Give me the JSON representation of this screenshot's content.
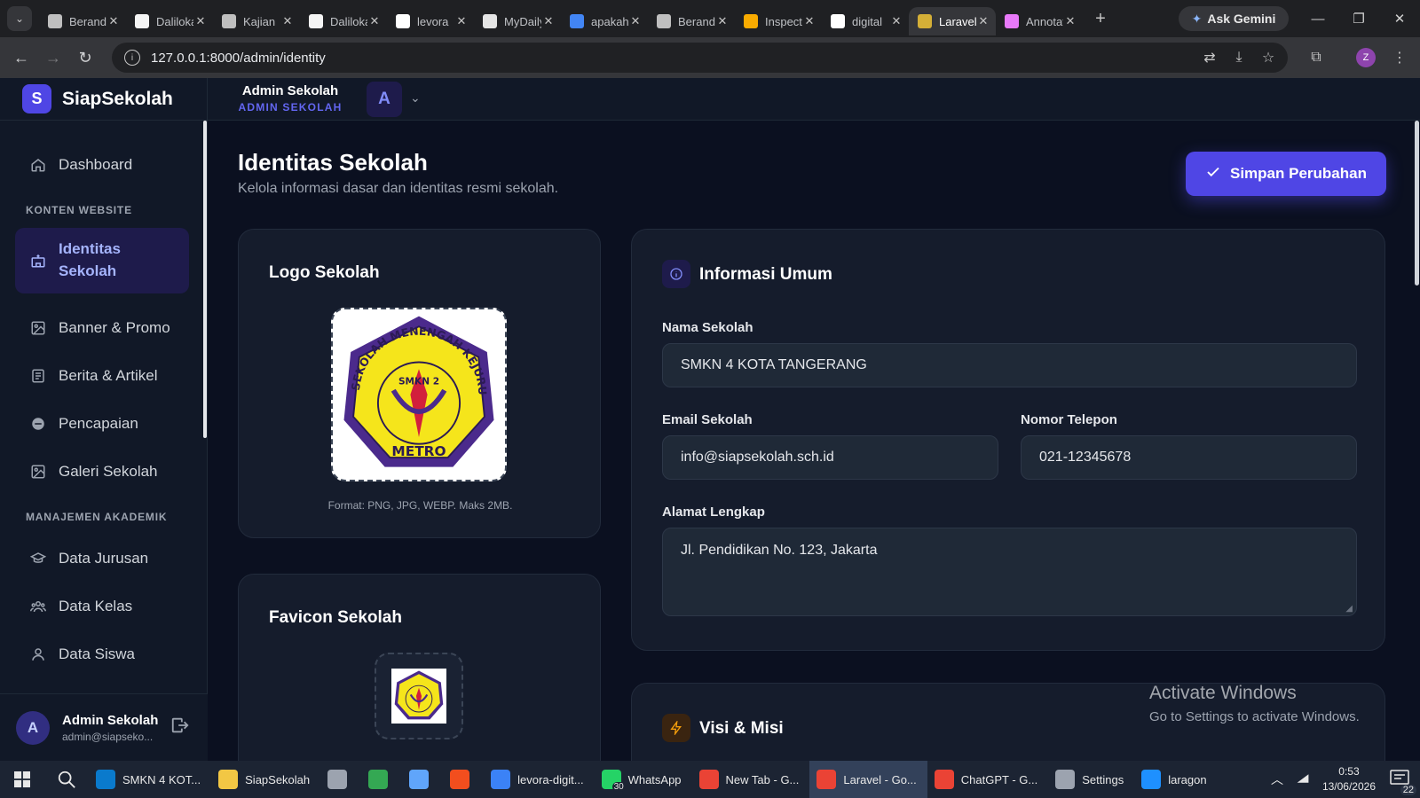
{
  "browser": {
    "tabs": [
      {
        "label": "Beranda",
        "icon": "pen-nib-icon",
        "color": "#bfbfbf"
      },
      {
        "label": "Daliloka",
        "icon": "doc-icon",
        "color": "#f5f5f5"
      },
      {
        "label": "Kajian",
        "icon": "globe-icon",
        "color": "#bfbfbf"
      },
      {
        "label": "Daliloka",
        "icon": "doc-icon",
        "color": "#f5f5f5"
      },
      {
        "label": "levora",
        "icon": "triangle-icon",
        "color": "#ffffff"
      },
      {
        "label": "MyDaily",
        "icon": "check-icon",
        "color": "#e5e5e5"
      },
      {
        "label": "apakah",
        "icon": "google-icon",
        "color": "#4285f4"
      },
      {
        "label": "Beranda",
        "icon": "pen-nib-icon",
        "color": "#bfbfbf"
      },
      {
        "label": "Inspect",
        "icon": "chart-icon",
        "color": "#f9ab00"
      },
      {
        "label": "digital",
        "icon": "triangle-icon",
        "color": "#ffffff"
      },
      {
        "label": "Laravel",
        "icon": "school-logo-icon",
        "color": "#d4af37"
      },
      {
        "label": "Annotate",
        "icon": "ring-icon",
        "color": "#e879f9"
      }
    ],
    "active_tab_index": 10,
    "gemini_label": "Ask Gemini",
    "url": "127.0.0.1:8000/admin/identity",
    "profile_initial": "Z"
  },
  "app": {
    "brand_initial": "S",
    "brand_name": "SiapSekolah",
    "topbar": {
      "user_name": "Admin Sekolah",
      "user_role": "ADMIN SEKOLAH",
      "avatar_initial": "A"
    },
    "sidebar": {
      "dashboard": "Dashboard",
      "section_content": "KONTEN WEBSITE",
      "identity": "Identitas Sekolah",
      "banner": "Banner & Promo",
      "news": "Berita & Artikel",
      "achievement": "Pencapaian",
      "gallery": "Galeri Sekolah",
      "section_academic": "MANAJEMEN AKADEMIK",
      "majors": "Data Jurusan",
      "classes": "Data Kelas",
      "students": "Data Siswa",
      "footer_name": "Admin Sekolah",
      "footer_email": "admin@siapseko...",
      "footer_initial": "A"
    },
    "page": {
      "title": "Identitas Sekolah",
      "subtitle": "Kelola informasi dasar dan identitas resmi sekolah.",
      "save_label": "Simpan Perubahan"
    },
    "logo_card": {
      "title": "Logo Sekolah",
      "hint": "Format: PNG, JPG, WEBP. Maks 2MB.",
      "logo_top_text": "SEKOLAH MENENGAH KEJURUAN NEGERI 2",
      "logo_inner": "SMKN 2",
      "logo_bottom": "METRO"
    },
    "favicon_card": {
      "title": "Favicon Sekolah"
    },
    "general_card": {
      "title": "Informasi Umum",
      "name_label": "Nama Sekolah",
      "name_value": "SMKN 4 KOTA TANGERANG",
      "email_label": "Email Sekolah",
      "email_value": "info@siapsekolah.sch.id",
      "phone_label": "Nomor Telepon",
      "phone_value": "021-12345678",
      "address_label": "Alamat Lengkap",
      "address_value": "Jl. Pendidikan No. 123, Jakarta"
    },
    "vision_card": {
      "title": "Visi & Misi"
    }
  },
  "watermark": {
    "line1": "Activate Windows",
    "line2": "Go to Settings to activate Windows."
  },
  "taskbar": {
    "items": [
      {
        "label": "SMKN 4 KOT...",
        "icon": "vscode-icon",
        "color": "#0a7acc"
      },
      {
        "label": "SiapSekolah",
        "icon": "folder-icon",
        "color": "#f2c744"
      },
      {
        "label": "",
        "icon": "paint-icon",
        "color": "#9ca3af"
      },
      {
        "label": "",
        "icon": "chrome-icon",
        "color": "#34a853"
      },
      {
        "label": "",
        "icon": "notepad-icon",
        "color": "#60a5fa"
      },
      {
        "label": "",
        "icon": "figma-icon",
        "color": "#f24e1e"
      },
      {
        "label": "levora-digit...",
        "icon": "triangle-icon",
        "color": "#3b82f6"
      },
      {
        "label": "WhatsApp",
        "icon": "whatsapp-icon",
        "color": "#25d366",
        "badge": "30"
      },
      {
        "label": "New Tab - G...",
        "icon": "chrome-icon",
        "color": "#ea4335"
      },
      {
        "label": "Laravel - Go...",
        "icon": "chrome-icon",
        "color": "#ea4335"
      },
      {
        "label": "ChatGPT - G...",
        "icon": "chrome-icon",
        "color": "#ea4335"
      },
      {
        "label": "Settings",
        "icon": "gear-icon",
        "color": "#9ca3af"
      },
      {
        "label": "laragon",
        "icon": "laragon-icon",
        "color": "#1e90ff"
      }
    ],
    "active_index": 9,
    "time": "0:53",
    "date": "13/06/2026",
    "notif_count": "22"
  }
}
